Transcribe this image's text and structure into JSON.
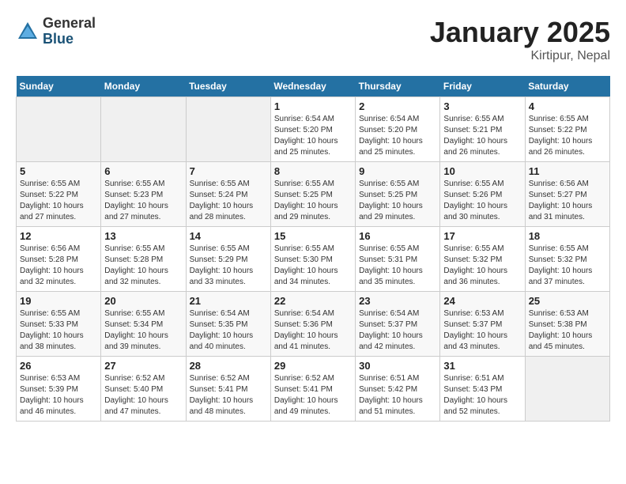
{
  "header": {
    "logo_general": "General",
    "logo_blue": "Blue",
    "month_title": "January 2025",
    "location": "Kirtipur, Nepal"
  },
  "calendar": {
    "days_of_week": [
      "Sunday",
      "Monday",
      "Tuesday",
      "Wednesday",
      "Thursday",
      "Friday",
      "Saturday"
    ],
    "weeks": [
      [
        {
          "day": "",
          "info": ""
        },
        {
          "day": "",
          "info": ""
        },
        {
          "day": "",
          "info": ""
        },
        {
          "day": "1",
          "info": "Sunrise: 6:54 AM\nSunset: 5:20 PM\nDaylight: 10 hours\nand 25 minutes."
        },
        {
          "day": "2",
          "info": "Sunrise: 6:54 AM\nSunset: 5:20 PM\nDaylight: 10 hours\nand 25 minutes."
        },
        {
          "day": "3",
          "info": "Sunrise: 6:55 AM\nSunset: 5:21 PM\nDaylight: 10 hours\nand 26 minutes."
        },
        {
          "day": "4",
          "info": "Sunrise: 6:55 AM\nSunset: 5:22 PM\nDaylight: 10 hours\nand 26 minutes."
        }
      ],
      [
        {
          "day": "5",
          "info": "Sunrise: 6:55 AM\nSunset: 5:22 PM\nDaylight: 10 hours\nand 27 minutes."
        },
        {
          "day": "6",
          "info": "Sunrise: 6:55 AM\nSunset: 5:23 PM\nDaylight: 10 hours\nand 27 minutes."
        },
        {
          "day": "7",
          "info": "Sunrise: 6:55 AM\nSunset: 5:24 PM\nDaylight: 10 hours\nand 28 minutes."
        },
        {
          "day": "8",
          "info": "Sunrise: 6:55 AM\nSunset: 5:25 PM\nDaylight: 10 hours\nand 29 minutes."
        },
        {
          "day": "9",
          "info": "Sunrise: 6:55 AM\nSunset: 5:25 PM\nDaylight: 10 hours\nand 29 minutes."
        },
        {
          "day": "10",
          "info": "Sunrise: 6:55 AM\nSunset: 5:26 PM\nDaylight: 10 hours\nand 30 minutes."
        },
        {
          "day": "11",
          "info": "Sunrise: 6:56 AM\nSunset: 5:27 PM\nDaylight: 10 hours\nand 31 minutes."
        }
      ],
      [
        {
          "day": "12",
          "info": "Sunrise: 6:56 AM\nSunset: 5:28 PM\nDaylight: 10 hours\nand 32 minutes."
        },
        {
          "day": "13",
          "info": "Sunrise: 6:55 AM\nSunset: 5:28 PM\nDaylight: 10 hours\nand 32 minutes."
        },
        {
          "day": "14",
          "info": "Sunrise: 6:55 AM\nSunset: 5:29 PM\nDaylight: 10 hours\nand 33 minutes."
        },
        {
          "day": "15",
          "info": "Sunrise: 6:55 AM\nSunset: 5:30 PM\nDaylight: 10 hours\nand 34 minutes."
        },
        {
          "day": "16",
          "info": "Sunrise: 6:55 AM\nSunset: 5:31 PM\nDaylight: 10 hours\nand 35 minutes."
        },
        {
          "day": "17",
          "info": "Sunrise: 6:55 AM\nSunset: 5:32 PM\nDaylight: 10 hours\nand 36 minutes."
        },
        {
          "day": "18",
          "info": "Sunrise: 6:55 AM\nSunset: 5:32 PM\nDaylight: 10 hours\nand 37 minutes."
        }
      ],
      [
        {
          "day": "19",
          "info": "Sunrise: 6:55 AM\nSunset: 5:33 PM\nDaylight: 10 hours\nand 38 minutes."
        },
        {
          "day": "20",
          "info": "Sunrise: 6:55 AM\nSunset: 5:34 PM\nDaylight: 10 hours\nand 39 minutes."
        },
        {
          "day": "21",
          "info": "Sunrise: 6:54 AM\nSunset: 5:35 PM\nDaylight: 10 hours\nand 40 minutes."
        },
        {
          "day": "22",
          "info": "Sunrise: 6:54 AM\nSunset: 5:36 PM\nDaylight: 10 hours\nand 41 minutes."
        },
        {
          "day": "23",
          "info": "Sunrise: 6:54 AM\nSunset: 5:37 PM\nDaylight: 10 hours\nand 42 minutes."
        },
        {
          "day": "24",
          "info": "Sunrise: 6:53 AM\nSunset: 5:37 PM\nDaylight: 10 hours\nand 43 minutes."
        },
        {
          "day": "25",
          "info": "Sunrise: 6:53 AM\nSunset: 5:38 PM\nDaylight: 10 hours\nand 45 minutes."
        }
      ],
      [
        {
          "day": "26",
          "info": "Sunrise: 6:53 AM\nSunset: 5:39 PM\nDaylight: 10 hours\nand 46 minutes."
        },
        {
          "day": "27",
          "info": "Sunrise: 6:52 AM\nSunset: 5:40 PM\nDaylight: 10 hours\nand 47 minutes."
        },
        {
          "day": "28",
          "info": "Sunrise: 6:52 AM\nSunset: 5:41 PM\nDaylight: 10 hours\nand 48 minutes."
        },
        {
          "day": "29",
          "info": "Sunrise: 6:52 AM\nSunset: 5:41 PM\nDaylight: 10 hours\nand 49 minutes."
        },
        {
          "day": "30",
          "info": "Sunrise: 6:51 AM\nSunset: 5:42 PM\nDaylight: 10 hours\nand 51 minutes."
        },
        {
          "day": "31",
          "info": "Sunrise: 6:51 AM\nSunset: 5:43 PM\nDaylight: 10 hours\nand 52 minutes."
        },
        {
          "day": "",
          "info": ""
        }
      ]
    ]
  }
}
